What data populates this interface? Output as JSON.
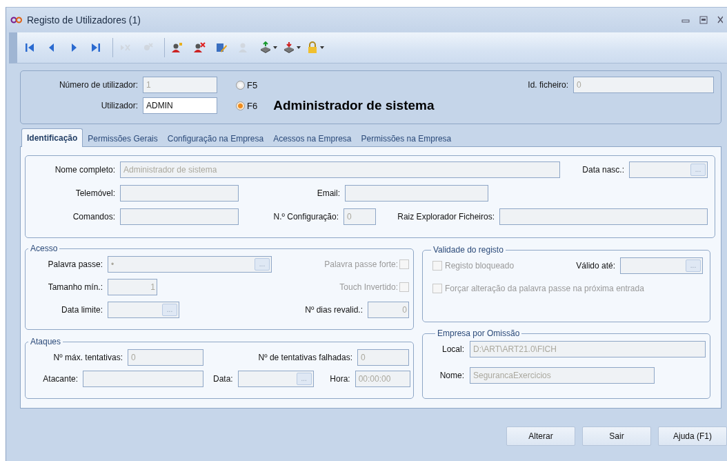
{
  "window": {
    "title": "Registo de Utilizadores (1)"
  },
  "toolbar": [
    {
      "kind": "button",
      "disabled": false,
      "dropdown": false
    },
    {
      "kind": "button",
      "disabled": false,
      "dropdown": false
    },
    {
      "kind": "button",
      "disabled": false,
      "dropdown": false
    },
    {
      "kind": "button",
      "disabled": false,
      "dropdown": false
    },
    {
      "kind": "separator"
    },
    {
      "kind": "button",
      "disabled": true,
      "dropdown": false
    },
    {
      "kind": "button",
      "disabled": true,
      "dropdown": false
    },
    {
      "kind": "separator"
    },
    {
      "kind": "button",
      "disabled": false,
      "dropdown": false
    },
    {
      "kind": "button",
      "disabled": false,
      "dropdown": false
    },
    {
      "kind": "button",
      "disabled": false,
      "dropdown": false
    },
    {
      "kind": "button",
      "disabled": true,
      "dropdown": false
    },
    {
      "kind": "button",
      "disabled": false,
      "dropdown": true
    },
    {
      "kind": "button",
      "disabled": false,
      "dropdown": true
    },
    {
      "kind": "button",
      "disabled": false,
      "dropdown": true
    }
  ],
  "header": {
    "numero": {
      "label": "Número de utilizador:",
      "value": "1",
      "disabled": true
    },
    "utilizador": {
      "label": "Utilizador:",
      "value": "ADMIN",
      "disabled": false
    },
    "radios": [
      {
        "label": "F5",
        "selected": false
      },
      {
        "label": "F6",
        "selected": true
      }
    ],
    "user_name": "Administrador de sistema",
    "id_ficheiro": {
      "label": "Id. ficheiro:",
      "value": "0",
      "disabled": true
    }
  },
  "tabs": [
    {
      "label": "Identificação",
      "selected": true
    },
    {
      "label": "Permissões Gerais",
      "selected": false
    },
    {
      "label": "Configuração na Empresa",
      "selected": false
    },
    {
      "label": "Acessos na Empresa",
      "selected": false
    },
    {
      "label": "Permissões na Empresa",
      "selected": false
    }
  ],
  "identificacao": [
    {
      "label": "Nome completo:",
      "value": "Administrador de sistema",
      "disabled": true
    },
    {
      "label": "Data nasc.:",
      "disabled": true,
      "button": "..."
    },
    {
      "label": "Telemóvel:",
      "disabled": true
    },
    {
      "label": "Email:",
      "disabled": true
    },
    {
      "label": "Comandos:",
      "disabled": true
    },
    {
      "label": "N.º Configuração:",
      "value": "0",
      "disabled": true
    },
    {
      "label": "Raiz Explorador Ficheiros:",
      "disabled": true
    }
  ],
  "acesso": {
    "title": "Acesso",
    "fields": [
      {
        "label": "Palavra passe:",
        "value": "•",
        "disabled": true,
        "button": "..."
      },
      {
        "label": "Tamanho mín.:",
        "value": "1",
        "disabled": true
      },
      {
        "label": "Data limite:",
        "disabled": true,
        "button": "..."
      },
      {
        "label": "Nº dias revalid.:",
        "value": "0",
        "disabled": true
      }
    ],
    "checkboxes": [
      {
        "label": "Palavra passe forte:",
        "checked": false,
        "disabled": true
      },
      {
        "label": "Touch Invertido:",
        "checked": false,
        "disabled": true
      }
    ]
  },
  "ataques": {
    "title": "Ataques",
    "fields": [
      {
        "label": "Nº máx. tentativas:",
        "value": "0",
        "disabled": true
      },
      {
        "label": "Nº de tentativas falhadas:",
        "value": "0",
        "disabled": true
      },
      {
        "label": "Atacante:",
        "disabled": true
      },
      {
        "label": "Data:",
        "disabled": true,
        "button": "..."
      },
      {
        "label": "Hora:",
        "value": "00:00:00",
        "disabled": true
      }
    ]
  },
  "validade": {
    "title": "Validade do registo",
    "checkboxes": [
      {
        "label": "Registo bloqueado",
        "checked": false,
        "disabled": true
      },
      {
        "label": "Forçar alteração da palavra passe na próxima entrada",
        "checked": false,
        "disabled": true
      }
    ],
    "valido_ate": {
      "label": "Válido até:",
      "disabled": true,
      "button": "..."
    }
  },
  "empresa": {
    "title": "Empresa por Omissão",
    "fields": [
      {
        "label": "Local:",
        "value": "D:\\ART\\ART21.0\\FICH",
        "disabled": true
      },
      {
        "label": "Nome:",
        "value": "SegurancaExercicios",
        "disabled": true
      }
    ]
  },
  "buttons": [
    "Alterar",
    "Sair",
    "Ajuda (F1)"
  ]
}
